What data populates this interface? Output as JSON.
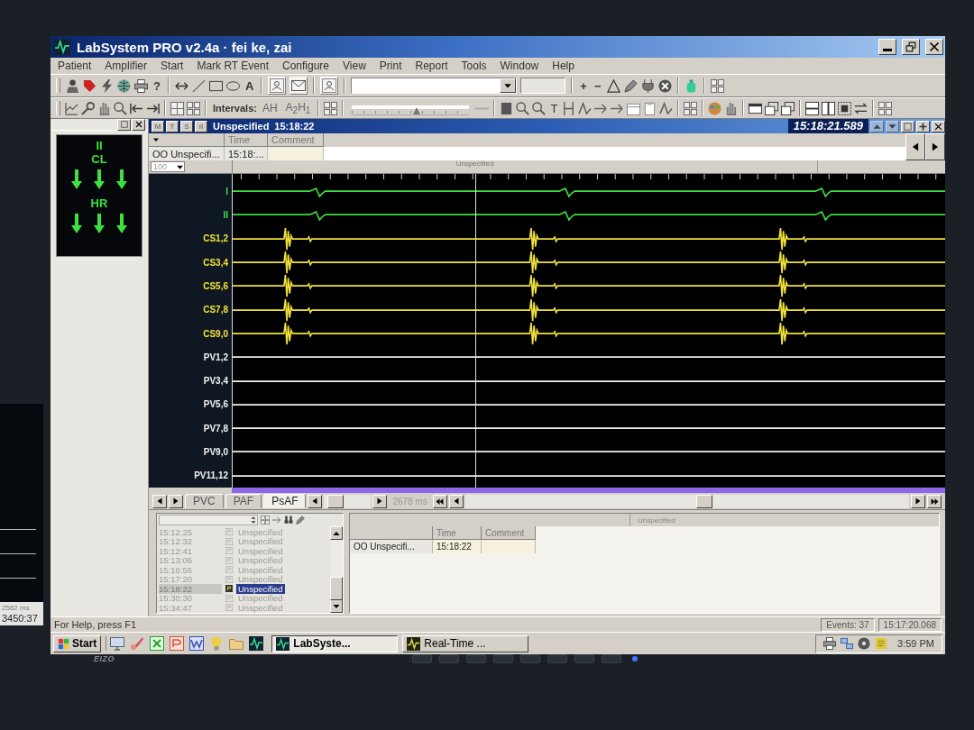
{
  "window": {
    "title": "LabSystem PRO v2.4a · fei ke, zai"
  },
  "menu": [
    "Patient",
    "Amplifier",
    "Start",
    "Mark RT Event",
    "Configure",
    "View",
    "Print",
    "Report",
    "Tools",
    "Window",
    "Help"
  ],
  "toolbar_1": {
    "help_button": "?",
    "text_tool": "A",
    "plus_button": "+",
    "minus_button": "−"
  },
  "toolbar_2": {
    "intervals_label": "Intervals:",
    "interval_buttons": [
      "AH",
      "A$_{2}$H$_{1}$"
    ],
    "text_button": "T",
    "zoom_slider": {
      "level": 0.55
    }
  },
  "indicator_panel": {
    "lead": "II",
    "groups": [
      {
        "label": "CL",
        "falling": true
      },
      {
        "label": "HR",
        "falling": true
      }
    ]
  },
  "event_bar": {
    "mode_buttons": [
      "M",
      "T",
      "S",
      "II"
    ],
    "event": "Unspecified",
    "event_time": "15:18:22",
    "clock": "15:18:21.589"
  },
  "event_table": {
    "columns": [
      "",
      "Time",
      "Comment"
    ],
    "rows": [
      {
        "cells": [
          "OO Unspecifi...",
          "15:18:..."
        ]
      }
    ]
  },
  "ruler": {
    "gain": "100",
    "marker": "Unspecified"
  },
  "channels": [
    {
      "label": "I",
      "kind": "ecg",
      "color": "#3ee03e"
    },
    {
      "label": "II",
      "kind": "ecg",
      "color": "#3ee03e"
    },
    {
      "label": "CS1,2",
      "kind": "spikes",
      "color": "#f2e23a"
    },
    {
      "label": "CS3,4",
      "kind": "spikes",
      "color": "#f2e23a"
    },
    {
      "label": "CS5,6",
      "kind": "spikes",
      "color": "#f2e23a"
    },
    {
      "label": "CS7,8",
      "kind": "spikes",
      "color": "#f2e23a"
    },
    {
      "label": "CS9,0",
      "kind": "spikes",
      "color": "#f2e23a"
    },
    {
      "label": "PV1,2",
      "kind": "flat",
      "color": "#f2f2f2"
    },
    {
      "label": "PV3,4",
      "kind": "flat",
      "color": "#f2f2f2"
    },
    {
      "label": "PV5,6",
      "kind": "flat",
      "color": "#f2f2f2"
    },
    {
      "label": "PV7,8",
      "kind": "flat",
      "color": "#f2f2f2"
    },
    {
      "label": "PV9,0",
      "kind": "flat",
      "color": "#f2f2f2"
    },
    {
      "label": "PV11,12",
      "kind": "flat",
      "color": "#f2f2f2"
    }
  ],
  "review_bar": {
    "tabs": [
      {
        "label": "PVC",
        "selected": false
      },
      {
        "label": "PAF",
        "selected": false
      },
      {
        "label": "PsAF",
        "selected": true
      }
    ],
    "duration": "2678 ms"
  },
  "event_list": {
    "rows": [
      {
        "time": "15:12:25",
        "label": "Unspecified",
        "selected": false
      },
      {
        "time": "15:12:32",
        "label": "Unspecified",
        "selected": false
      },
      {
        "time": "15:12:41",
        "label": "Unspecified",
        "selected": false
      },
      {
        "time": "15:13:06",
        "label": "Unspecified",
        "selected": false
      },
      {
        "time": "15:16:56",
        "label": "Unspecified",
        "selected": false
      },
      {
        "time": "15:17:20",
        "label": "Unspecified",
        "selected": false
      },
      {
        "time": "15:18:22",
        "label": "Unspecified",
        "selected": true
      },
      {
        "time": "15:30:30",
        "label": "Unspecified",
        "selected": false
      },
      {
        "time": "15:34:47",
        "label": "Unspecified",
        "selected": false
      }
    ]
  },
  "detail_table": {
    "marker": "Unspecified",
    "columns": [
      "",
      "Time",
      "Comment"
    ],
    "rows": [
      {
        "cells": [
          "OO Unspecifi...",
          "15:18:22"
        ]
      }
    ]
  },
  "status_bar": {
    "help": "For Help, press F1",
    "events": "Events: 37",
    "time": "15:17:20.068"
  },
  "taskbar": {
    "start": "Start",
    "tasks": [
      {
        "label": "LabSyste...",
        "selected": true
      },
      {
        "label": "Real-Time ...",
        "selected": false
      }
    ],
    "clock": "3:59 PM"
  },
  "side_monitor": {
    "texts": [
      "2562 ms",
      "3450:37"
    ]
  },
  "monitor": {
    "logo": "EIZO"
  }
}
